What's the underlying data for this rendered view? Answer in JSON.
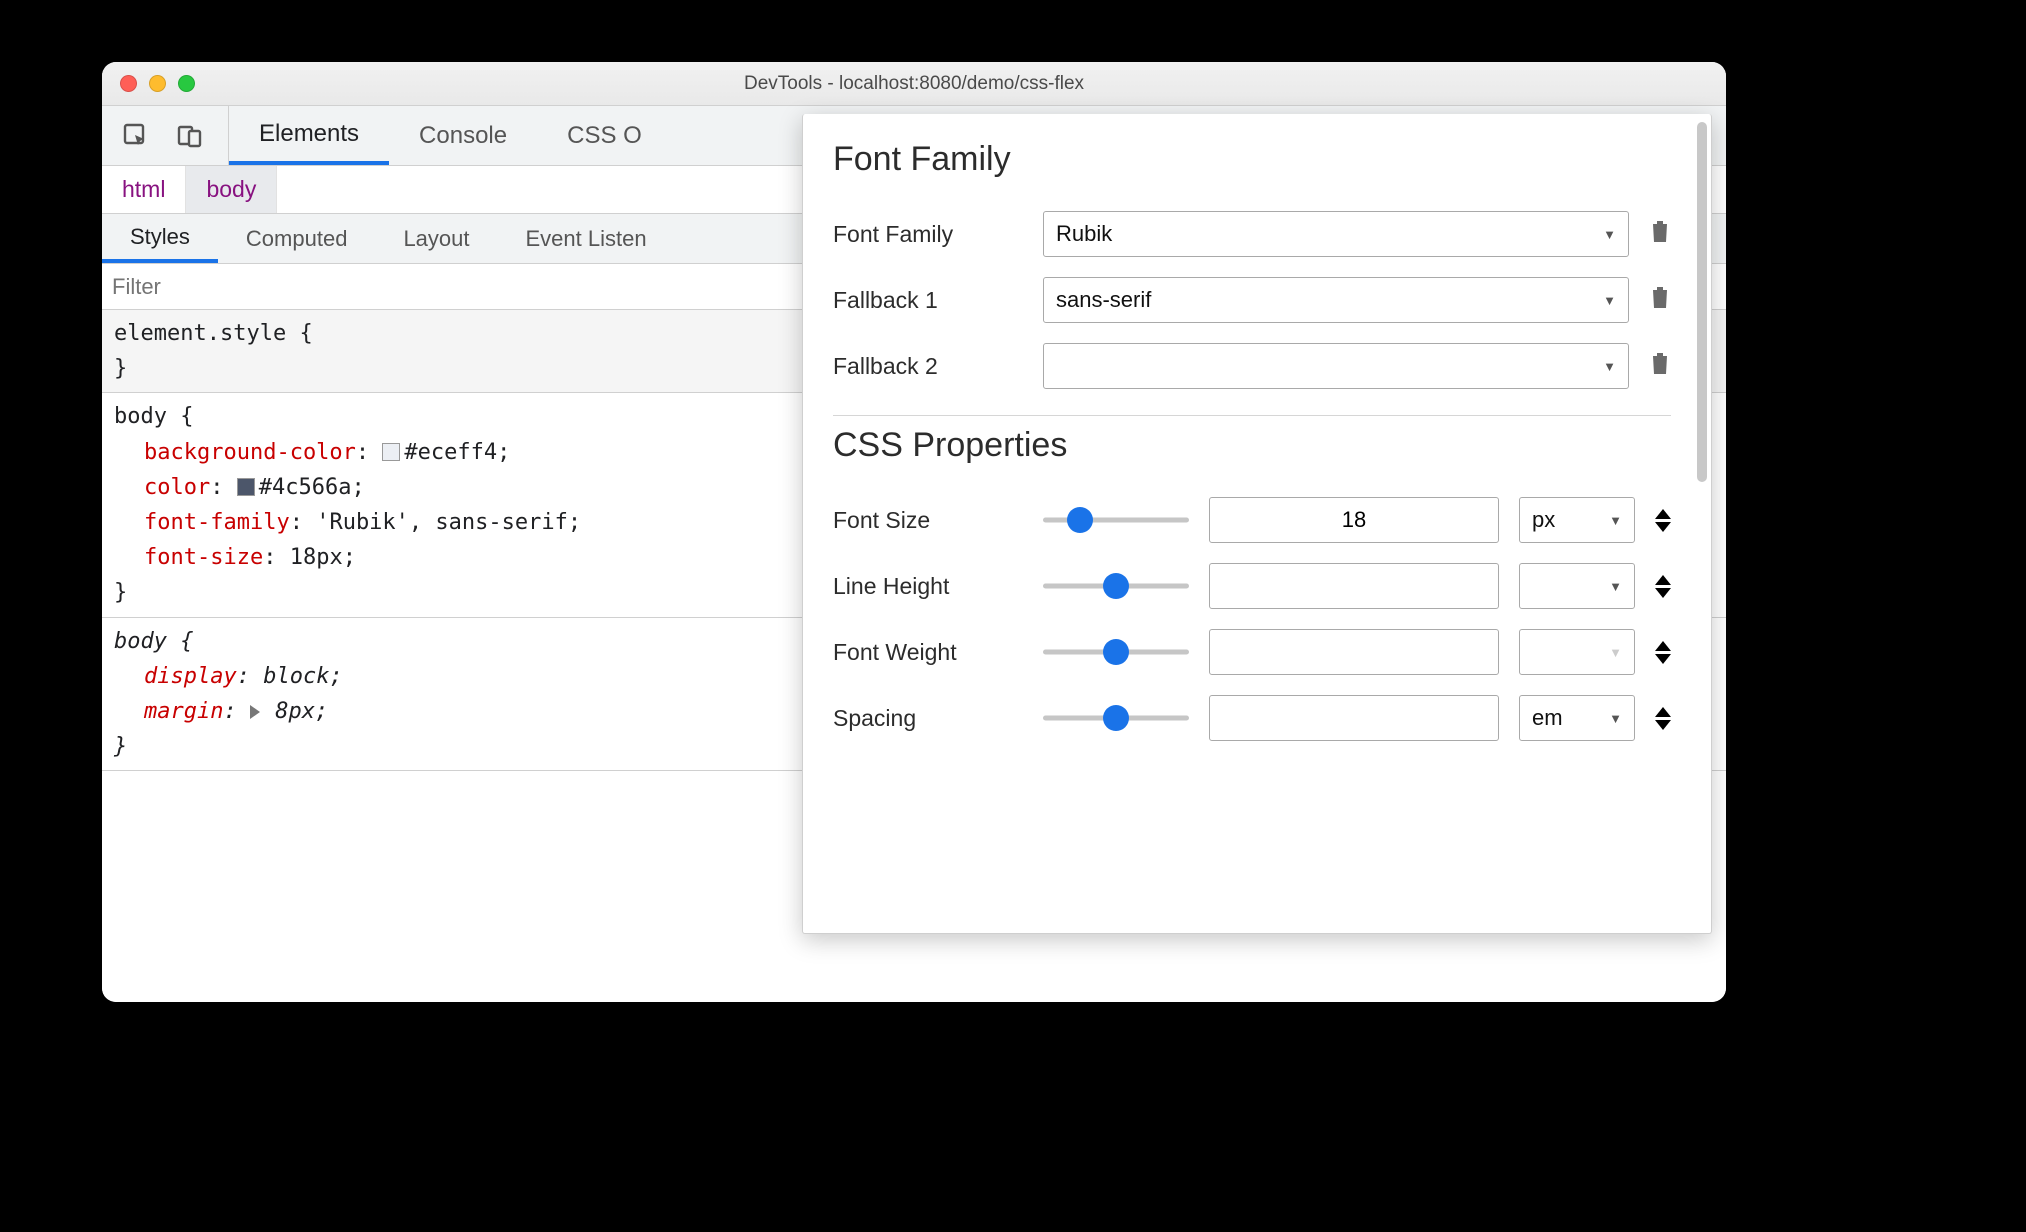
{
  "window": {
    "title": "DevTools - localhost:8080/demo/css-flex"
  },
  "main_tabs": {
    "items": [
      {
        "label": "Elements",
        "active": true
      },
      {
        "label": "Console",
        "active": false
      },
      {
        "label": "CSS O",
        "active": false,
        "truncated": true
      }
    ]
  },
  "breadcrumbs": {
    "items": [
      {
        "label": "html",
        "selected": false
      },
      {
        "label": "body",
        "selected": true
      }
    ]
  },
  "sub_tabs": {
    "items": [
      {
        "label": "Styles",
        "active": true
      },
      {
        "label": "Computed",
        "active": false
      },
      {
        "label": "Layout",
        "active": false
      },
      {
        "label": "Event Listen",
        "active": false,
        "truncated": true
      }
    ]
  },
  "filter": {
    "placeholder": "Filter"
  },
  "rules": {
    "element_style": {
      "selector": "element.style"
    },
    "body_rule": {
      "selector": "body",
      "decls": [
        {
          "prop": "background-color",
          "swatch": "#eceff4",
          "val": "#eceff4"
        },
        {
          "prop": "color",
          "swatch": "#4c566a",
          "val": "#4c566a"
        },
        {
          "prop": "font-family",
          "val": "'Rubik', sans-serif"
        },
        {
          "prop": "font-size",
          "val": "18px"
        }
      ]
    },
    "body_ua_rule": {
      "selector": "body",
      "decls": [
        {
          "prop": "display",
          "val": "block",
          "italic": true
        },
        {
          "prop": "margin",
          "val": "8px",
          "italic": true,
          "expand": true
        }
      ]
    }
  },
  "popup": {
    "section1_heading": "Font Family",
    "font_family": {
      "label": "Font Family",
      "value": "Rubik"
    },
    "fallback1": {
      "label": "Fallback 1",
      "value": "sans-serif"
    },
    "fallback2": {
      "label": "Fallback 2",
      "value": ""
    },
    "section2_heading": "CSS Properties",
    "props": {
      "font_size": {
        "label": "Font Size",
        "value": "18",
        "unit": "px",
        "slider_pos": 0.25
      },
      "line_height": {
        "label": "Line Height",
        "value": "",
        "unit": "",
        "slider_pos": 0.5
      },
      "font_weight": {
        "label": "Font Weight",
        "value": "",
        "unit": "",
        "slider_pos": 0.5,
        "unit_disabled": true
      },
      "spacing": {
        "label": "Spacing",
        "value": "",
        "unit": "em",
        "slider_pos": 0.5
      }
    }
  }
}
